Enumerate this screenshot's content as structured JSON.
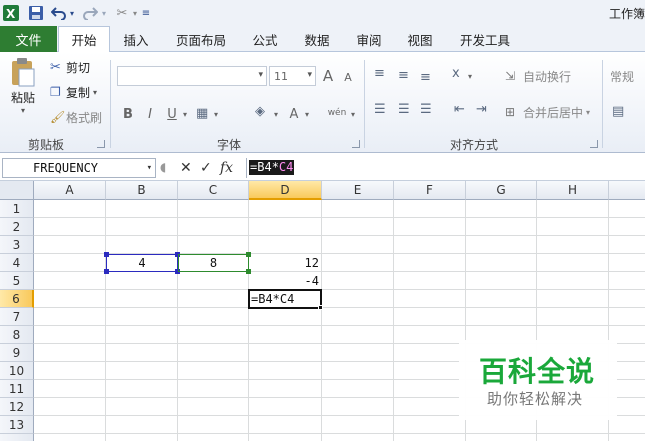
{
  "titlebar": {
    "app_icon": "excel-logo-icon",
    "save_icon": "save-icon",
    "undo_icon": "undo-icon",
    "redo_icon": "redo-icon",
    "tool_icon": "tool-icon",
    "customize_icon": "customize-qat-icon",
    "title": "工作簿"
  },
  "tabs": {
    "file": "文件",
    "items": [
      "开始",
      "插入",
      "页面布局",
      "公式",
      "数据",
      "审阅",
      "视图",
      "开发工具"
    ],
    "active": "开始",
    "file_color": "#2e7d32"
  },
  "ribbon": {
    "clipboard": {
      "paste": "粘贴",
      "cut": "剪切",
      "copy": "复制",
      "format_painter": "格式刷",
      "group_label": "剪贴板"
    },
    "font": {
      "size": "11",
      "grow": "A",
      "shrink": "A",
      "bold": "B",
      "italic": "I",
      "underline": "U",
      "font_color": "A",
      "phonetic": "wén",
      "group_label": "字体"
    },
    "alignment": {
      "wrap_text": "自动换行",
      "merge_center": "合并后居中",
      "group_label": "对齐方式"
    },
    "number": {
      "format": "常规"
    }
  },
  "formula_bar": {
    "name_box": "FREQUENCY",
    "cancel": "✕",
    "enter": "✓",
    "fx": "fx",
    "formula_prefix": "=",
    "formula_ref1": "B4",
    "formula_op": "*",
    "formula_ref2": "C4"
  },
  "sheet": {
    "columns": [
      "A",
      "B",
      "C",
      "D",
      "E",
      "F",
      "G",
      "H"
    ],
    "rows": [
      "1",
      "2",
      "3",
      "4",
      "5",
      "6",
      "7",
      "8",
      "9",
      "10",
      "11",
      "12",
      "13"
    ],
    "selected_column": "D",
    "selected_row": "6",
    "cells": {
      "B4": "4",
      "C4": "8",
      "D4": "12",
      "D5": "-4",
      "D6": "=B4*C4"
    }
  },
  "watermark": {
    "title": "百科全说",
    "subtitle": "助你轻松解决",
    "color": "#1aa83a"
  }
}
